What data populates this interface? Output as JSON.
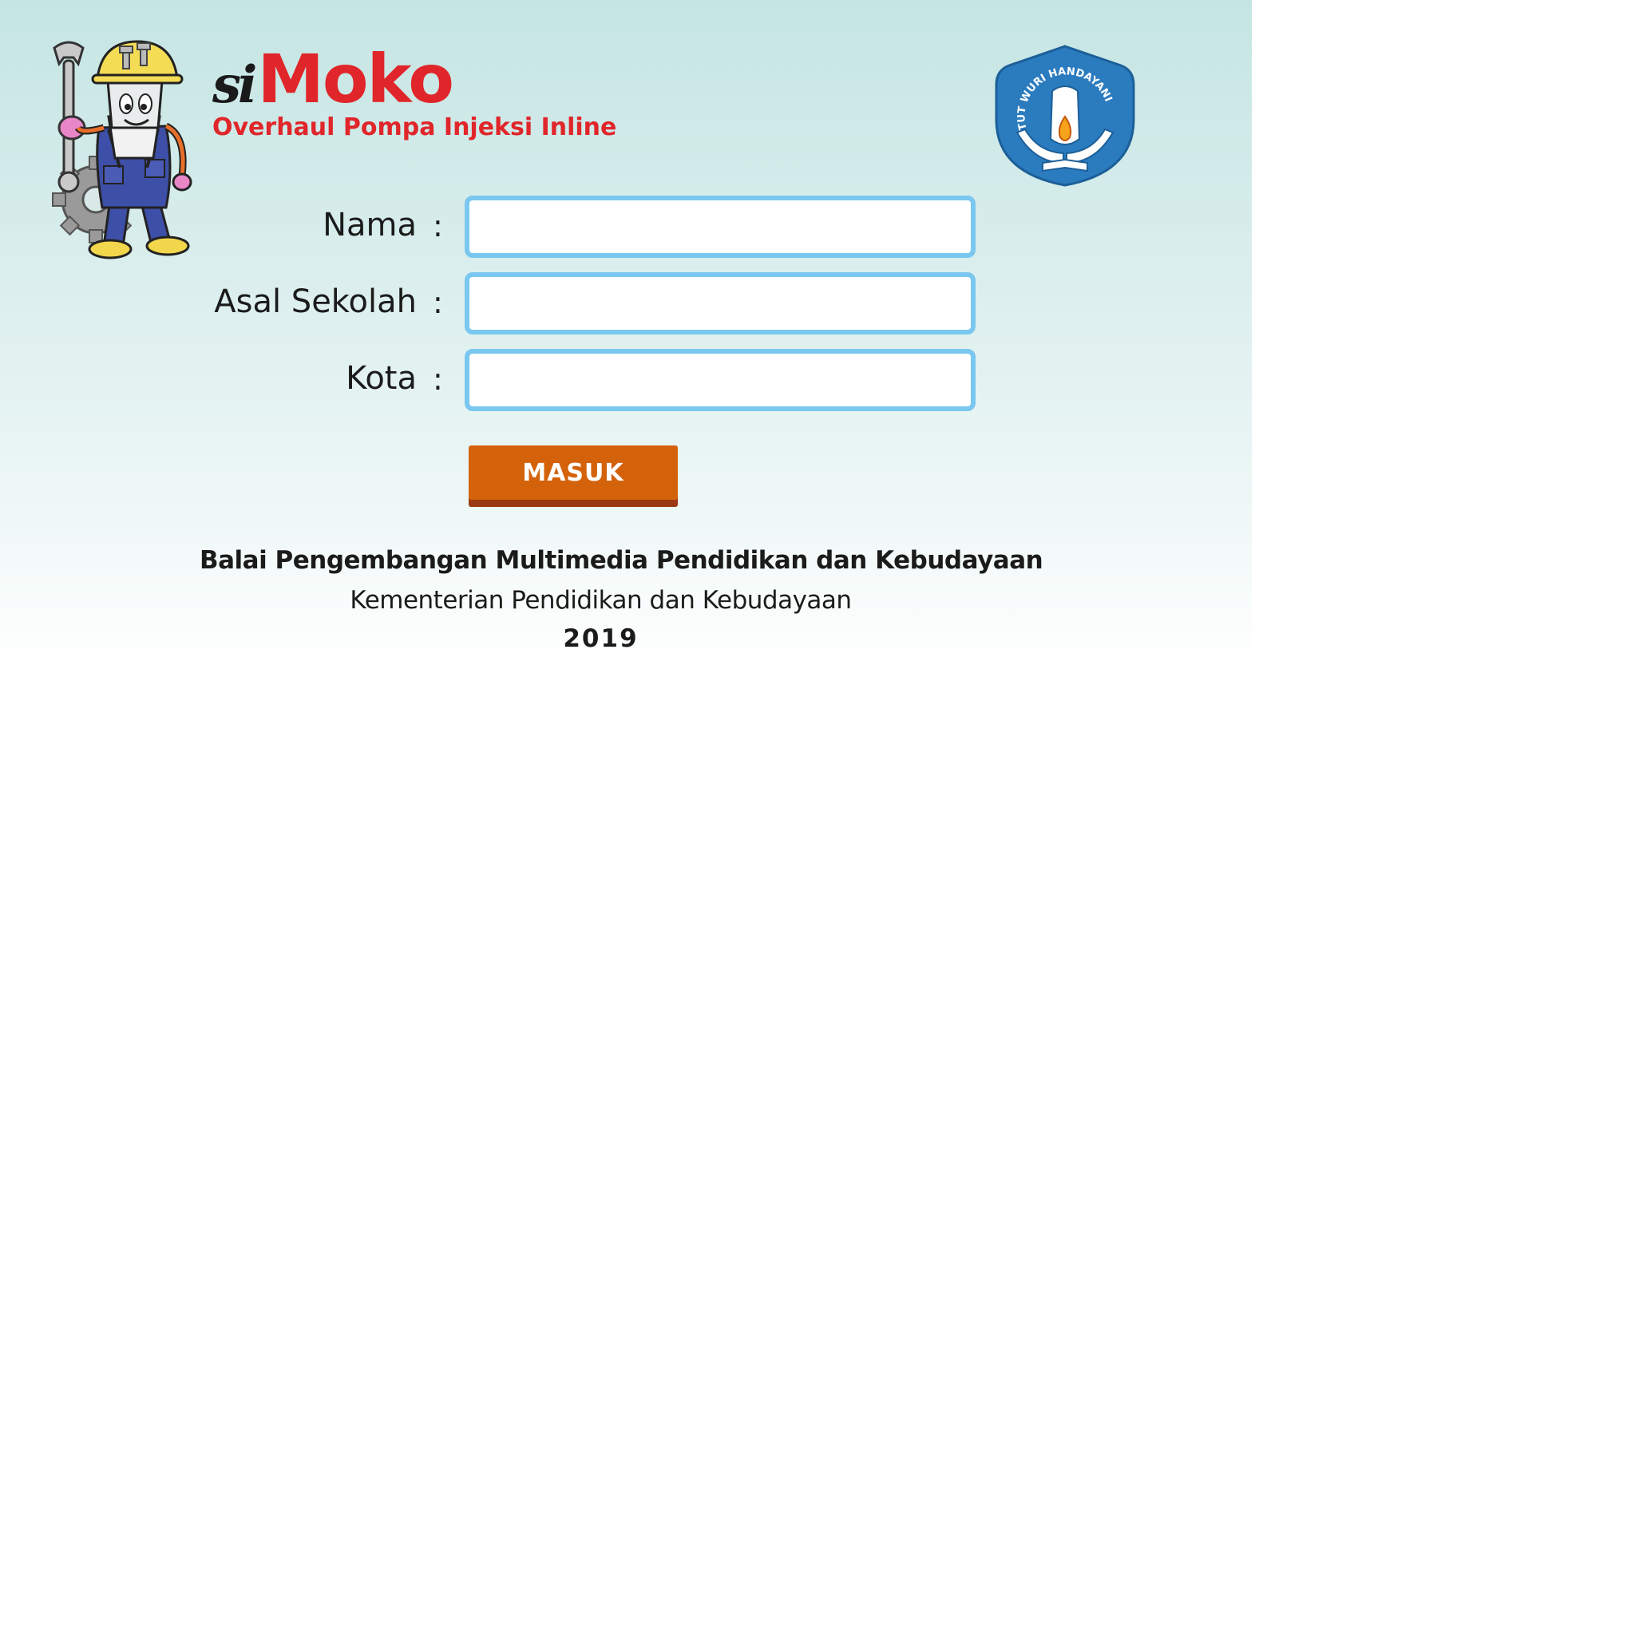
{
  "app": {
    "brand_prefix": "si",
    "brand_name": "Moko",
    "subtitle": "Overhaul Pompa Injeksi Inline",
    "emblem_motto": "TUT WURI HANDAYANI"
  },
  "form": {
    "separator": ":",
    "fields": [
      {
        "label": "Nama",
        "value": "",
        "placeholder": ""
      },
      {
        "label": "Asal Sekolah",
        "value": "",
        "placeholder": ""
      },
      {
        "label": "Kota",
        "value": "",
        "placeholder": ""
      }
    ],
    "submit_label": "MASUK"
  },
  "footer": {
    "line1": "Balai Pengembangan Multimedia Pendidikan dan Kebudayaan",
    "line2": "Kementerian Pendidikan dan Kebudayaan",
    "line3": "2019"
  },
  "colors": {
    "brand_red": "#e0262a",
    "field_border": "#7ac7ef",
    "button": "#d4620a",
    "button_shadow": "#9b3a12",
    "emblem_blue": "#2b7bbf"
  },
  "icons": {
    "mascot": "mechanic-mascot-icon",
    "emblem": "tut-wuri-handayani-emblem-icon"
  }
}
